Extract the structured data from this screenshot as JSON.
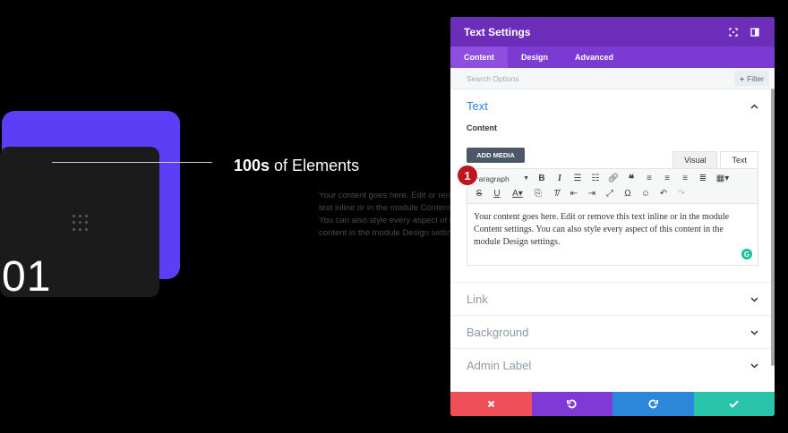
{
  "preview": {
    "number": "01",
    "heading_bold": "100s",
    "heading_rest": " of Elements",
    "body_lines": [
      "Your content goes here. Edit or remove",
      "text inline or in the module Content se",
      "You can also style every aspect of this",
      "content in the module Design settings."
    ]
  },
  "panel": {
    "title": "Text Settings",
    "tabs": [
      {
        "label": "Content",
        "active": true
      },
      {
        "label": "Design",
        "active": false
      },
      {
        "label": "Advanced",
        "active": false
      }
    ],
    "search_placeholder": "Search Options",
    "filter_label": "Filter",
    "text_section": {
      "title": "Text",
      "content_label": "Content",
      "add_media_label": "ADD MEDIA",
      "visual_tab": "Visual",
      "text_tab": "Text",
      "format_select": "Paragraph",
      "editor_content": "Your content goes here. Edit or remove this text inline or in the module Content settings. You can also style every aspect of this content in the module Design settings.",
      "badge_number": "1"
    },
    "collapsed_sections": [
      {
        "title": "Link"
      },
      {
        "title": "Background"
      },
      {
        "title": "Admin Label"
      }
    ]
  },
  "colors": {
    "accent_purple": "#6c2eb9",
    "cancel_red": "#ef4f57",
    "undo_purple": "#7f3ad6",
    "redo_blue": "#2b87da",
    "save_green": "#29c4a9"
  }
}
